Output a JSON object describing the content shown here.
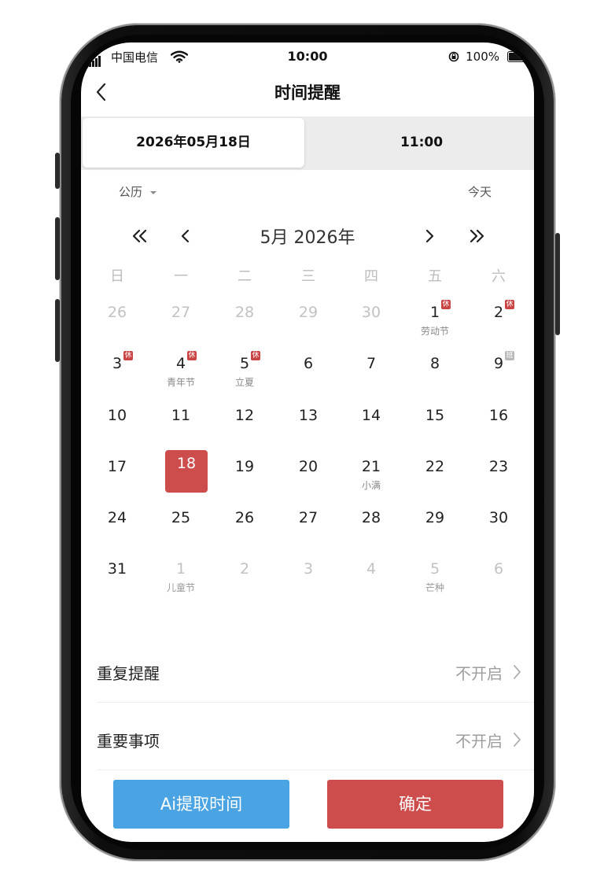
{
  "status_bar": {
    "carrier": "中国电信",
    "time": "10:00",
    "battery": "100%"
  },
  "nav": {
    "title": "时间提醒"
  },
  "segment": {
    "date_label": "2026年05月18日",
    "time_label": "11:00"
  },
  "calendar": {
    "type_label": "公历",
    "today_label": "今天",
    "month_title": "5月 2026年",
    "weekdays": [
      "日",
      "一",
      "二",
      "三",
      "四",
      "五",
      "六"
    ],
    "weeks": [
      [
        {
          "day": "26",
          "muted": true
        },
        {
          "day": "27",
          "muted": true
        },
        {
          "day": "28",
          "muted": true
        },
        {
          "day": "29",
          "muted": true
        },
        {
          "day": "30",
          "muted": true
        },
        {
          "day": "1",
          "sub": "劳动节",
          "tag": "休"
        },
        {
          "day": "2",
          "tag": "休"
        }
      ],
      [
        {
          "day": "3",
          "tag": "休"
        },
        {
          "day": "4",
          "sub": "青年节",
          "tag": "休"
        },
        {
          "day": "5",
          "sub": "立夏",
          "tag": "休"
        },
        {
          "day": "6"
        },
        {
          "day": "7"
        },
        {
          "day": "8"
        },
        {
          "day": "9",
          "tag": "班",
          "tag_type": "work"
        }
      ],
      [
        {
          "day": "10"
        },
        {
          "day": "11"
        },
        {
          "day": "12"
        },
        {
          "day": "13"
        },
        {
          "day": "14"
        },
        {
          "day": "15"
        },
        {
          "day": "16"
        }
      ],
      [
        {
          "day": "17"
        },
        {
          "day": "18",
          "selected": true
        },
        {
          "day": "19"
        },
        {
          "day": "20"
        },
        {
          "day": "21",
          "sub": "小满"
        },
        {
          "day": "22"
        },
        {
          "day": "23"
        }
      ],
      [
        {
          "day": "24"
        },
        {
          "day": "25"
        },
        {
          "day": "26"
        },
        {
          "day": "27"
        },
        {
          "day": "28"
        },
        {
          "day": "29"
        },
        {
          "day": "30"
        }
      ],
      [
        {
          "day": "31"
        },
        {
          "day": "1",
          "muted": true,
          "sub": "儿童节"
        },
        {
          "day": "2",
          "muted": true
        },
        {
          "day": "3",
          "muted": true
        },
        {
          "day": "4",
          "muted": true
        },
        {
          "day": "5",
          "muted": true,
          "sub": "芒种"
        },
        {
          "day": "6",
          "muted": true
        }
      ]
    ]
  },
  "settings": [
    {
      "label": "重复提醒",
      "value": "不开启"
    },
    {
      "label": "重要事项",
      "value": "不开启"
    }
  ],
  "buttons": {
    "ai_label": "Ai提取时间",
    "confirm_label": "确定"
  },
  "colors": {
    "accent_red": "#cd4d4d",
    "accent_blue": "#4aa3e3",
    "holiday_tag": "#c94545",
    "workday_tag": "#b9b9b9"
  }
}
